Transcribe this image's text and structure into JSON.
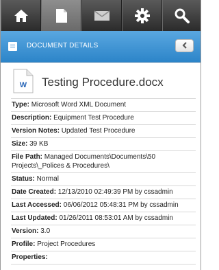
{
  "nav": {
    "items": [
      {
        "name": "home-button",
        "icon": "home-icon"
      },
      {
        "name": "documents-button",
        "icon": "document-icon",
        "active": true
      },
      {
        "name": "mail-button",
        "icon": "envelope-icon"
      },
      {
        "name": "settings-button",
        "icon": "gear-icon"
      },
      {
        "name": "search-button",
        "icon": "search-icon"
      }
    ]
  },
  "header": {
    "title": "DOCUMENT DETAILS",
    "back_icon": "chevron-left-icon"
  },
  "document": {
    "icon_letter": "W",
    "title": "Testing Procedure.docx"
  },
  "properties": [
    {
      "label": "Type:",
      "value": " Microsoft Word XML Document"
    },
    {
      "label": "Description:",
      "value": " Equipment Test Procedure"
    },
    {
      "label": "Version Notes:",
      "value": " Updated Test Procedure"
    },
    {
      "label": "Size:",
      "value": " 39 KB"
    },
    {
      "label": "File Path:",
      "value": " Managed Documents\\Documents\\50 Projects\\_Polices & Procedures\\"
    },
    {
      "label": "Status:",
      "value": " Normal"
    },
    {
      "label": "Date Created:",
      "value": " 12/13/2010 02:49:39 PM by cssadmin"
    },
    {
      "label": "Last Accessed:",
      "value": " 06/06/2012 05:48:31 PM by cssadmin"
    },
    {
      "label": "Last Updated:",
      "value": " 01/26/2011 08:53:01 AM by cssadmin"
    },
    {
      "label": "Version:",
      "value": " 3.0"
    },
    {
      "label": "Profile:",
      "value": " Project Procedures"
    },
    {
      "label": "Properties:",
      "value": ""
    }
  ],
  "colors": {
    "header_blue": "#3b93d6",
    "nav_dark": "#3a3a3a"
  }
}
